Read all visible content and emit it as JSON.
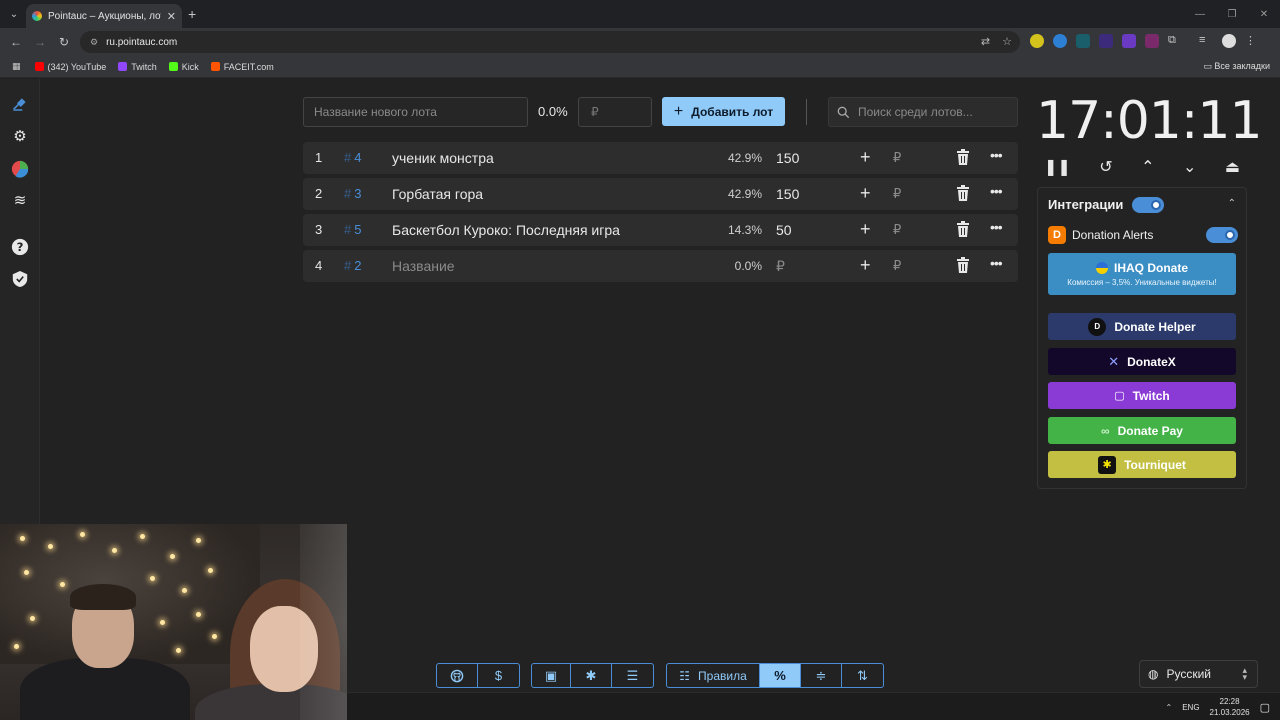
{
  "browser": {
    "tab_title": "Pointauc – Аукционы, лотереи",
    "url": "ru.pointauc.com",
    "bookmarks": [
      {
        "label": "(342) YouTube",
        "color": "#ff0000"
      },
      {
        "label": "Twitch",
        "color": "#9146ff"
      },
      {
        "label": "Kick",
        "color": "#53fc18"
      },
      {
        "label": "FACEIT.com",
        "color": "#ff5500"
      }
    ],
    "all_bookmarks": "Все закладки"
  },
  "toolbar": {
    "lot_placeholder": "Название нового лота",
    "percent": "0.0%",
    "amount_placeholder": "₽",
    "add_label": "Добавить лот",
    "search_placeholder": "Поиск среди лотов..."
  },
  "lots": [
    {
      "num": "1",
      "id": "4",
      "name": "ученик монстра",
      "percent": "42.9%",
      "amount": "150"
    },
    {
      "num": "2",
      "id": "3",
      "name": "Горбатая гора",
      "percent": "42.9%",
      "amount": "150"
    },
    {
      "num": "3",
      "id": "5",
      "name": "Баскетбол Куроко: Последняя игра",
      "percent": "14.3%",
      "amount": "50"
    },
    {
      "num": "4",
      "id": "2",
      "name": "Название",
      "percent": "0.0%",
      "amount": "₽"
    }
  ],
  "currency": "₽",
  "timer": "17:01:11",
  "integrations": {
    "title": "Интеграции",
    "donation_alerts": "Donation Alerts",
    "ihaq_title": "IHAQ Donate",
    "ihaq_sub": "Комиссия – 3,5%. Уникальные виджеты!",
    "services": [
      {
        "label": "Donate Helper",
        "color": "#2b3a6b"
      },
      {
        "label": "DonateX",
        "color": "#14082a"
      },
      {
        "label": "Twitch",
        "color": "#8a3bd6"
      },
      {
        "label": "Donate Pay",
        "color": "#43b348"
      },
      {
        "label": "Tourniquet",
        "color": "#c2bf43"
      }
    ]
  },
  "bottom_bar": {
    "rules_label": "Правила"
  },
  "language": "Русский",
  "taskbar": {
    "lang": "ENG",
    "time": "22:28",
    "date": "21.03.2026"
  }
}
